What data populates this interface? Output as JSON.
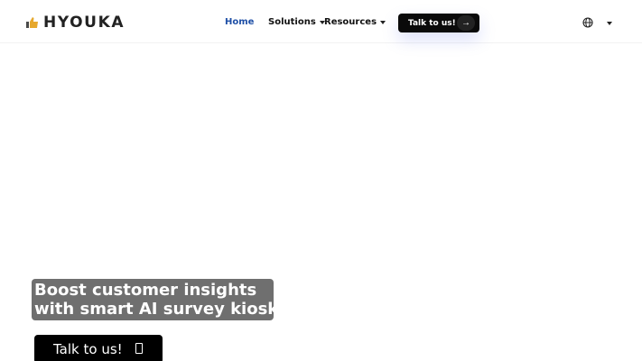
{
  "header": {
    "brand": "HYOUKA",
    "nav": [
      {
        "label": "Home",
        "active": true
      },
      {
        "label": "Solutions",
        "has_dropdown": true
      },
      {
        "label": "Resources",
        "has_dropdown": true
      }
    ],
    "cta_label": "Talk to us!",
    "cta_icon": "arrow-right-icon",
    "language_icon": "globe-icon"
  },
  "hero": {
    "title_line1": "Boost customer insights",
    "title_line2": "with smart AI survey kiosk",
    "cta_label": "Talk to us!",
    "cta_icon": "phone-icon"
  },
  "colors": {
    "accent": "#1e4fa6",
    "button_bg": "#0a0a0a",
    "logo_thumb": "#e6a82e"
  }
}
